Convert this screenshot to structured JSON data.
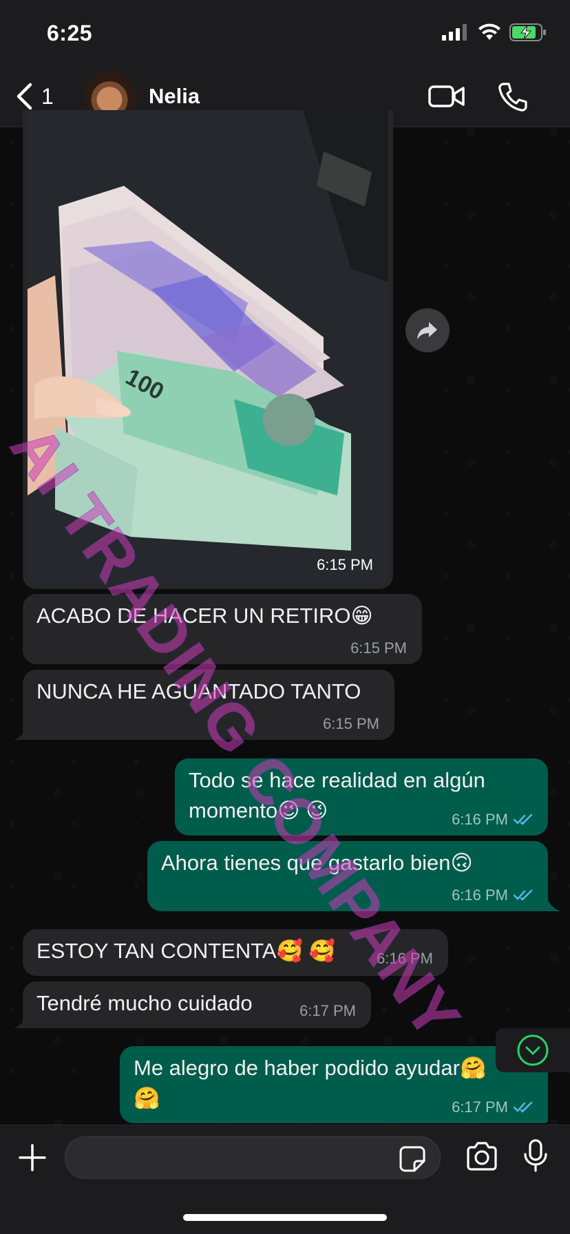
{
  "status_bar": {
    "time": "6:25"
  },
  "header": {
    "back_count": "1",
    "contact_name": "Nelia"
  },
  "messages": [
    {
      "direction": "incoming",
      "type": "image",
      "time": "6:15 PM"
    },
    {
      "direction": "incoming",
      "text": "ACABO DE HACER UN RETIRO😁",
      "time": "6:15 PM"
    },
    {
      "direction": "incoming",
      "text": "NUNCA HE AGUANTADO TANTO",
      "time": "6:15 PM"
    },
    {
      "direction": "outgoing",
      "text_line1": "Todo se hace realidad en algún",
      "text_line2": "momento😉 😉",
      "time": "6:16 PM"
    },
    {
      "direction": "outgoing",
      "text": "Ahora tienes que gastarlo bien🙃",
      "time": "6:16 PM"
    },
    {
      "direction": "incoming",
      "text": "ESTOY TAN CONTENTA🥰 🥰",
      "time": "6:16 PM"
    },
    {
      "direction": "incoming",
      "text": "Tendré mucho cuidado",
      "time": "6:17 PM"
    },
    {
      "direction": "outgoing",
      "text_line1": "Me alegro de haber podido ayudar🤗",
      "text_line2": "🤗",
      "time": "6:17 PM"
    }
  ],
  "watermark": "AI TRADING COMPANY",
  "colors": {
    "incoming": "#262628",
    "outgoing": "#005c4b",
    "tick_read": "#53bdeb",
    "accent": "#25d366"
  }
}
